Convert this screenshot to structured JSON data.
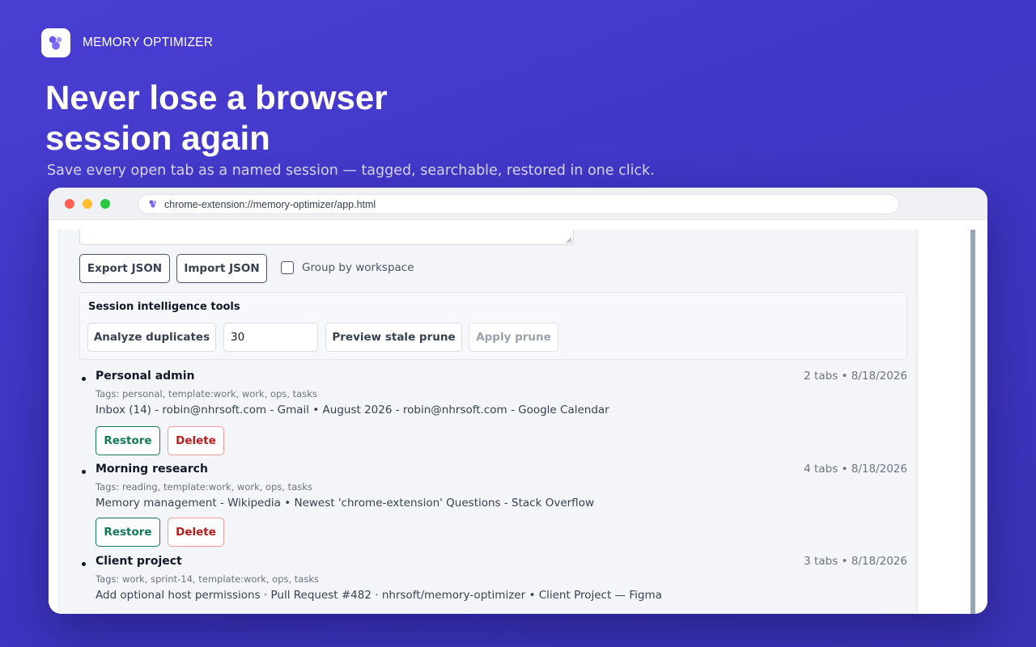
{
  "brand": {
    "name": "MEMORY OPTIMIZER",
    "logo_icon": "bubbles-logo-icon"
  },
  "hero": {
    "headline_line1": "Never lose a browser",
    "headline_line2": "session again",
    "subhead": "Save every open tab as a named session — tagged, searchable, restored in one click."
  },
  "browser": {
    "url": "chrome-extension://memory-optimizer/app.html"
  },
  "toolbar": {
    "export_label": "Export JSON",
    "import_label": "Import JSON",
    "group_label": "Group by workspace",
    "group_checked": false
  },
  "tools": {
    "title": "Session intelligence tools",
    "analyze_label": "Analyze duplicates",
    "days_value": "30",
    "preview_label": "Preview stale prune",
    "apply_label": "Apply prune"
  },
  "sessions": [
    {
      "name": "Personal admin",
      "meta": "2 tabs • 8/18/2026",
      "tags": "Tags: personal, template:work, work, ops, tasks",
      "titles": "Inbox (14) - robin@nhrsoft.com - Gmail • August 2026 - robin@nhrsoft.com - Google Calendar",
      "restore_label": "Restore",
      "delete_label": "Delete"
    },
    {
      "name": "Morning research",
      "meta": "4 tabs • 8/18/2026",
      "tags": "Tags: reading, template:work, work, ops, tasks",
      "titles": "Memory management - Wikipedia • Newest 'chrome-extension' Questions - Stack Overflow",
      "restore_label": "Restore",
      "delete_label": "Delete"
    },
    {
      "name": "Client project",
      "meta": "3 tabs • 8/18/2026",
      "tags": "Tags: work, sprint-14, template:work, ops, tasks",
      "titles": "Add optional host permissions · Pull Request #482 · nhrsoft/memory-optimizer • Client Project — Figma",
      "restore_label": "Restore",
      "delete_label": "Delete"
    }
  ],
  "colors": {
    "background": "#4a3ed3",
    "restore": "#0f7a55",
    "delete": "#b91c1c",
    "window_dots": [
      "#fe5f57",
      "#febc2e",
      "#28c840"
    ]
  }
}
